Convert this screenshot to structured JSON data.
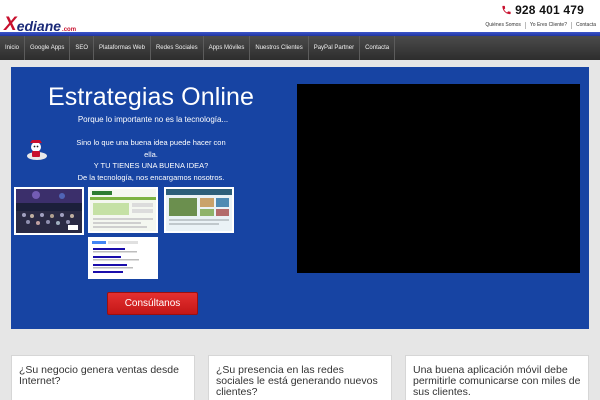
{
  "header": {
    "logo_text": "ediane",
    "logo_tld": ".com",
    "phone": "928 401 479",
    "top_links": [
      "Quiénes Somos",
      "Yo Eres Cliente?",
      "Contacta"
    ]
  },
  "nav": {
    "items": [
      "Inicio",
      "Google Apps",
      "SEO",
      "Plataformas Web",
      "Redes Sociales",
      "Apps Móviles",
      "Nuestros Clientes",
      "PayPal Partner",
      "Contacta"
    ]
  },
  "hero": {
    "title": "Estrategias Online",
    "subtitle": "Porque lo importante no es la tecnología...",
    "pitch_line1": "Sino lo que una buena idea puede hacer con ella.",
    "pitch_line2": "Y TU TIENES UNA BUENA IDEA?",
    "pitch_line3": "De la tecnología, nos encargamos nosotros.",
    "cta_label": "Consúltanos"
  },
  "cards": [
    {
      "text": "¿Su negocio genera ventas desde Internet?"
    },
    {
      "text": "¿Su presencia en las redes sociales le está generando nuevos clientes?"
    },
    {
      "text": "Una buena aplicación móvil debe permitirle comunicarse con miles de sus clientes."
    }
  ],
  "colors": {
    "hero_bg": "#1744a3",
    "cta": "#d62222",
    "nav_bg": "#3a3a3a",
    "brand_blue": "#1b2a78",
    "brand_red": "#c8102e"
  },
  "icons": {
    "phone": "phone-icon",
    "mascot": "mascot-icon"
  }
}
